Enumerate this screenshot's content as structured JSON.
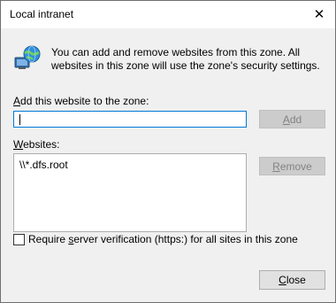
{
  "window": {
    "title": "Local intranet",
    "close_glyph": "✕"
  },
  "info": {
    "icon": "globe-computer-icon",
    "text": "You can add and remove websites from this zone. All websites in this zone will use the zone's security settings."
  },
  "add_site": {
    "label_mnemonic": "A",
    "label_rest": "dd this website to the zone:",
    "input_value": "",
    "add_button_mnemonic": "A",
    "add_button_rest": "dd"
  },
  "websites": {
    "label_mnemonic": "W",
    "label_rest": "ebsites:",
    "items": [
      "\\\\*.dfs.root"
    ],
    "remove_button_mnemonic": "R",
    "remove_button_rest": "emove"
  },
  "verification": {
    "checked": false,
    "label_before": "Require ",
    "label_mnemonic": "s",
    "label_after": "erver verification (https:) for all sites in this zone"
  },
  "footer": {
    "close_mnemonic": "C",
    "close_rest": "lose"
  }
}
